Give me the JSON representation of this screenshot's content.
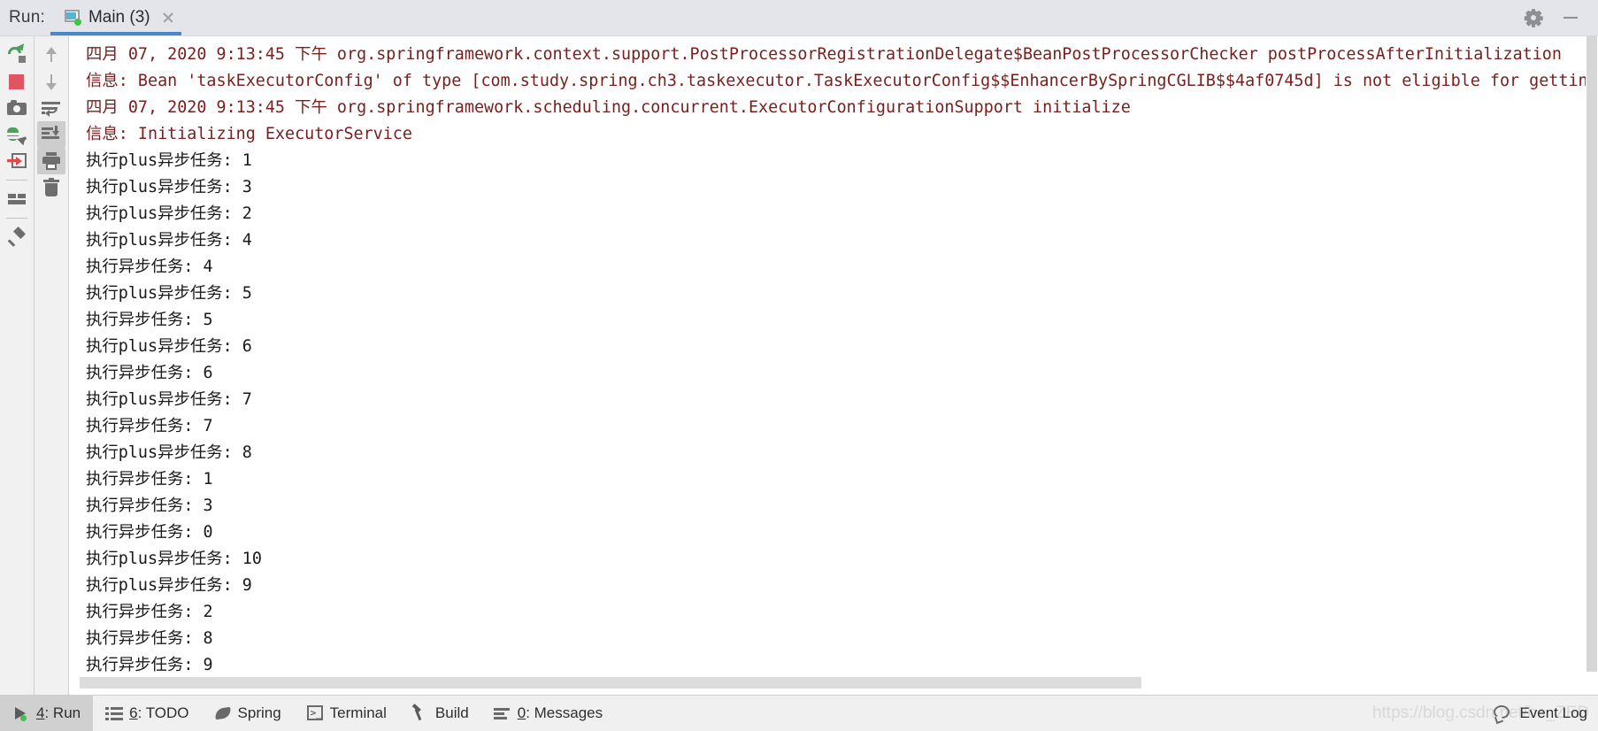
{
  "header": {
    "run_label": "Run:",
    "tab": {
      "title": "Main (3)",
      "icon": "run-config-icon",
      "close_icon": "close-icon"
    },
    "settings_icon": "gear-icon",
    "minimize_icon": "minimize-icon"
  },
  "left_toolbar": {
    "buttons": [
      {
        "name": "rerun-button",
        "icon": "rerun-icon"
      },
      {
        "name": "stop-button",
        "icon": "stop-icon"
      },
      {
        "name": "screenshot-button",
        "icon": "camera-icon"
      },
      {
        "name": "thread-dump-button",
        "icon": "bug-export-icon"
      },
      {
        "name": "exit-button",
        "icon": "arrow-into-box-icon"
      },
      {
        "name": "layout-button",
        "icon": "layout-icon"
      },
      {
        "name": "pin-tab-button",
        "icon": "pin-icon"
      }
    ]
  },
  "right_toolbar": {
    "buttons": [
      {
        "name": "up-button",
        "icon": "arrow-up-icon"
      },
      {
        "name": "down-button",
        "icon": "arrow-down-icon"
      },
      {
        "name": "soft-wrap-button",
        "icon": "soft-wrap-icon"
      },
      {
        "name": "scroll-to-end-button",
        "icon": "scroll-to-end-icon"
      },
      {
        "name": "print-button",
        "icon": "printer-icon"
      },
      {
        "name": "clear-all-button",
        "icon": "trash-icon"
      }
    ]
  },
  "console": {
    "lines": [
      {
        "type": "log",
        "text": "四月 07, 2020 9:13:45 下午 org.springframework.context.support.PostProcessorRegistrationDelegate$BeanPostProcessorChecker postProcessAfterInitialization"
      },
      {
        "type": "log",
        "text": "信息: Bean 'taskExecutorConfig' of type [com.study.spring.ch3.taskexecutor.TaskExecutorConfig$$EnhancerBySpringCGLIB$$4af0745d] is not eligible for getting processed by a"
      },
      {
        "type": "log",
        "text": "四月 07, 2020 9:13:45 下午 org.springframework.scheduling.concurrent.ExecutorConfigurationSupport initialize"
      },
      {
        "type": "log",
        "text": "信息: Initializing ExecutorService"
      },
      {
        "type": "out",
        "text": "执行plus异步任务: 1"
      },
      {
        "type": "out",
        "text": "执行plus异步任务: 3"
      },
      {
        "type": "out",
        "text": "执行plus异步任务: 2"
      },
      {
        "type": "out",
        "text": "执行plus异步任务: 4"
      },
      {
        "type": "out",
        "text": "执行异步任务: 4"
      },
      {
        "type": "out",
        "text": "执行plus异步任务: 5"
      },
      {
        "type": "out",
        "text": "执行异步任务: 5"
      },
      {
        "type": "out",
        "text": "执行plus异步任务: 6"
      },
      {
        "type": "out",
        "text": "执行异步任务: 6"
      },
      {
        "type": "out",
        "text": "执行plus异步任务: 7"
      },
      {
        "type": "out",
        "text": "执行异步任务: 7"
      },
      {
        "type": "out",
        "text": "执行plus异步任务: 8"
      },
      {
        "type": "out",
        "text": "执行异步任务: 1"
      },
      {
        "type": "out",
        "text": "执行异步任务: 3"
      },
      {
        "type": "out",
        "text": "执行异步任务: 0"
      },
      {
        "type": "out",
        "text": "执行plus异步任务: 10"
      },
      {
        "type": "out",
        "text": "执行plus异步任务: 9"
      },
      {
        "type": "out",
        "text": "执行异步任务: 2"
      },
      {
        "type": "out",
        "text": "执行异步任务: 8"
      },
      {
        "type": "out",
        "text": "执行异步任务: 9"
      }
    ],
    "log_color": "#7a1d1d",
    "output_color": "#1a1a1a"
  },
  "statusbar": {
    "items": [
      {
        "name": "statusbar-run",
        "key": "4",
        "label": ": Run",
        "icon": "run-icon",
        "active": true
      },
      {
        "name": "statusbar-todo",
        "key": "6",
        "label": ": TODO",
        "icon": "todo-icon",
        "active": false
      },
      {
        "name": "statusbar-spring",
        "key": "",
        "label": "Spring",
        "icon": "spring-leaf-icon",
        "active": false
      },
      {
        "name": "statusbar-terminal",
        "key": "",
        "label": "Terminal",
        "icon": "terminal-icon",
        "active": false
      },
      {
        "name": "statusbar-build",
        "key": "",
        "label": "Build",
        "icon": "hammer-icon",
        "active": false
      },
      {
        "name": "statusbar-messages",
        "key": "0",
        "label": ": Messages",
        "icon": "messages-icon",
        "active": false
      }
    ],
    "event_log": {
      "label": "Event Log",
      "icon": "speech-bubble-icon"
    },
    "watermark": "https://blog.csdn.net/he_ZED"
  }
}
